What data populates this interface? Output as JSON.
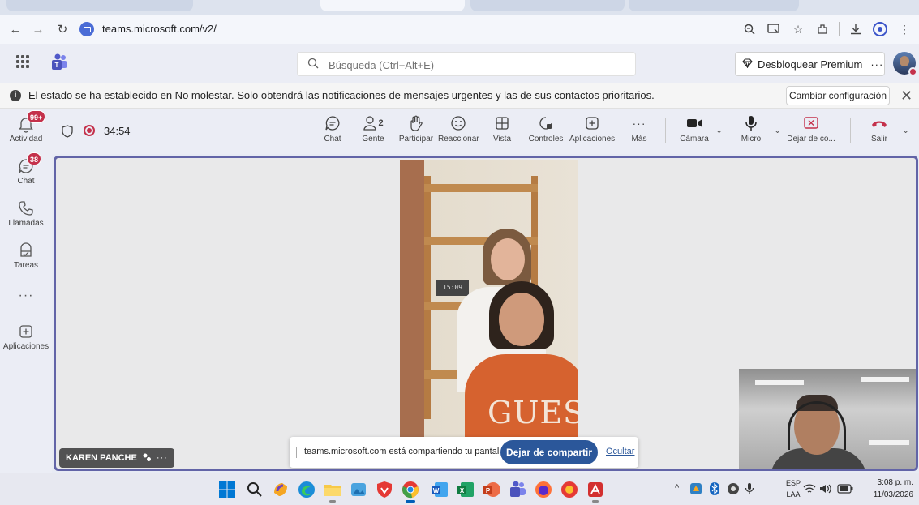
{
  "browser": {
    "url": "teams.microsoft.com/v2/"
  },
  "header": {
    "search_placeholder": "Búsqueda (Ctrl+Alt+E)",
    "premium_label": "Desbloquear Premium",
    "premium_more": "···"
  },
  "banner": {
    "message": "El estado se ha establecido en No molestar. Solo obtendrá las notificaciones de mensajes urgentes y las de sus contactos prioritarios.",
    "button_label": "Cambiar configuración",
    "close_glyph": "✕"
  },
  "rail": {
    "items": [
      {
        "label": "Actividad",
        "badge": "99+",
        "icon": "bell-icon"
      },
      {
        "label": "Chat",
        "badge": "38",
        "icon": "chat-icon"
      },
      {
        "label": "Llamadas",
        "badge": "",
        "icon": "phone-icon"
      },
      {
        "label": "Tareas",
        "badge": "",
        "icon": "tasks-icon"
      },
      {
        "label": "",
        "badge": "",
        "icon": "more-icon",
        "glyph": "···"
      },
      {
        "label": "Aplicaciones",
        "badge": "",
        "icon": "plus-icon"
      }
    ]
  },
  "meeting": {
    "timer": "34:54",
    "people_count": "2",
    "toolbar": {
      "chat": "Chat",
      "people": "Gente",
      "raise_hand": "Participar",
      "react": "Reaccionar",
      "view": "Vista",
      "controls": "Controles",
      "apps": "Aplicaciones",
      "more": "Más",
      "camera": "Cámara",
      "mic": "Micro",
      "stop_share": "Dejar de co...",
      "leave": "Salir"
    },
    "participant_name": "KAREN PANCHE",
    "clock_display": "15:09",
    "shirt_text": "GUES"
  },
  "share_bar": {
    "message": "teams.microsoft.com está compartiendo tu pantalla.",
    "stop_label": "Dejar de compartir",
    "hide_label": "Ocultar"
  },
  "taskbar": {
    "lang_top": "ESP",
    "lang_bottom": "LAA",
    "time": "3:08 p. m.",
    "date": "11/03/2026"
  },
  "colors": {
    "teams_accent": "#6264a7",
    "danger": "#c4314b",
    "share_button": "#2b579a"
  }
}
